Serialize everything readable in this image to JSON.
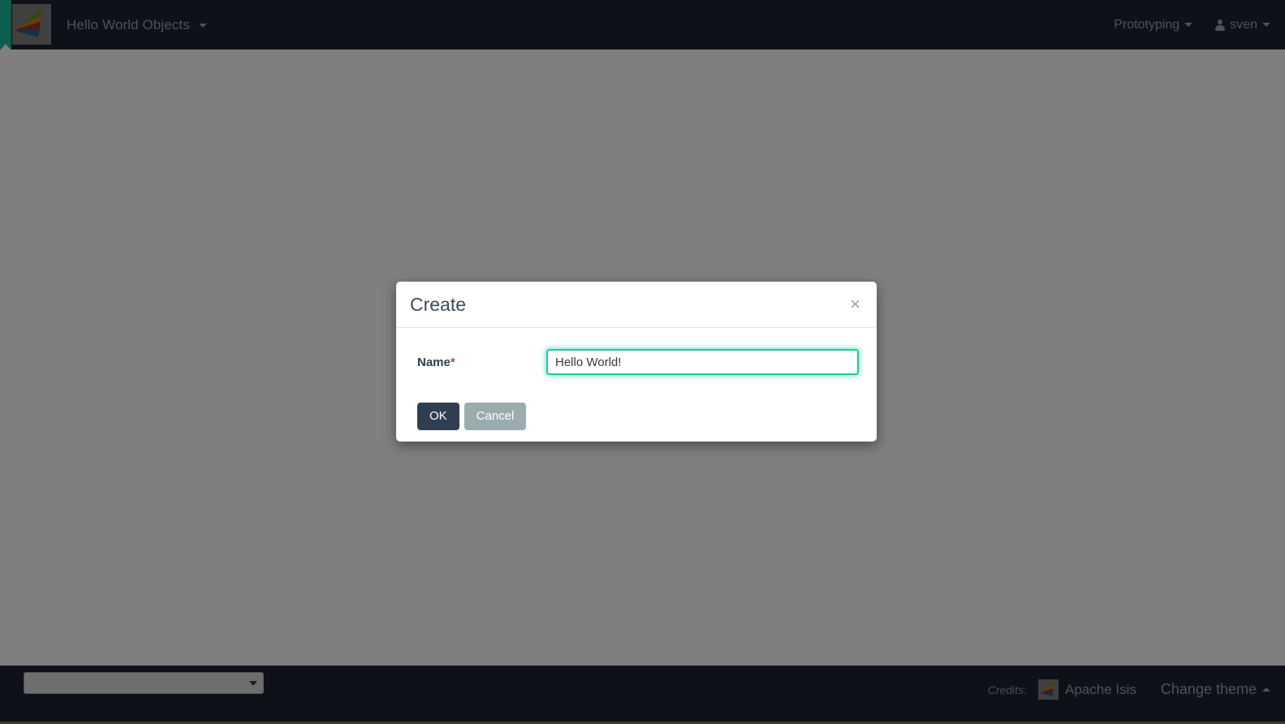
{
  "header": {
    "brand_logo_icon": "apache-isis-fan-logo",
    "brand_title": "Hello World Objects",
    "nav_right": {
      "prototyping_label": "Prototyping",
      "user_icon": "user-icon",
      "user_label": "sven"
    }
  },
  "modal": {
    "title": "Create",
    "close_icon": "×",
    "field": {
      "label": "Name",
      "required_marker": "*",
      "value": "Hello World!",
      "placeholder": ""
    },
    "buttons": {
      "ok_label": "OK",
      "cancel_label": "Cancel"
    }
  },
  "footer": {
    "theme_select_value": "",
    "theme_select_arrow_icon": "chevron-down-icon",
    "credits_label": "Credits:",
    "credit_logo_icon": "apache-isis-fan-logo",
    "credit_link_label": "Apache Isis",
    "change_theme_label": "Change theme",
    "change_theme_caret_icon": "chevron-up-icon"
  },
  "colors": {
    "navbar_bg": "#1c2430",
    "accent_teal": "#1abc9c",
    "focus_green": "#1dc9a0",
    "btn_primary": "#2f3e50",
    "btn_secondary": "#9bacaf",
    "required_red": "#b94a48",
    "footer_bottom_rule": "#8a7550",
    "backdrop": "rgba(0,0,0,0.5)"
  }
}
